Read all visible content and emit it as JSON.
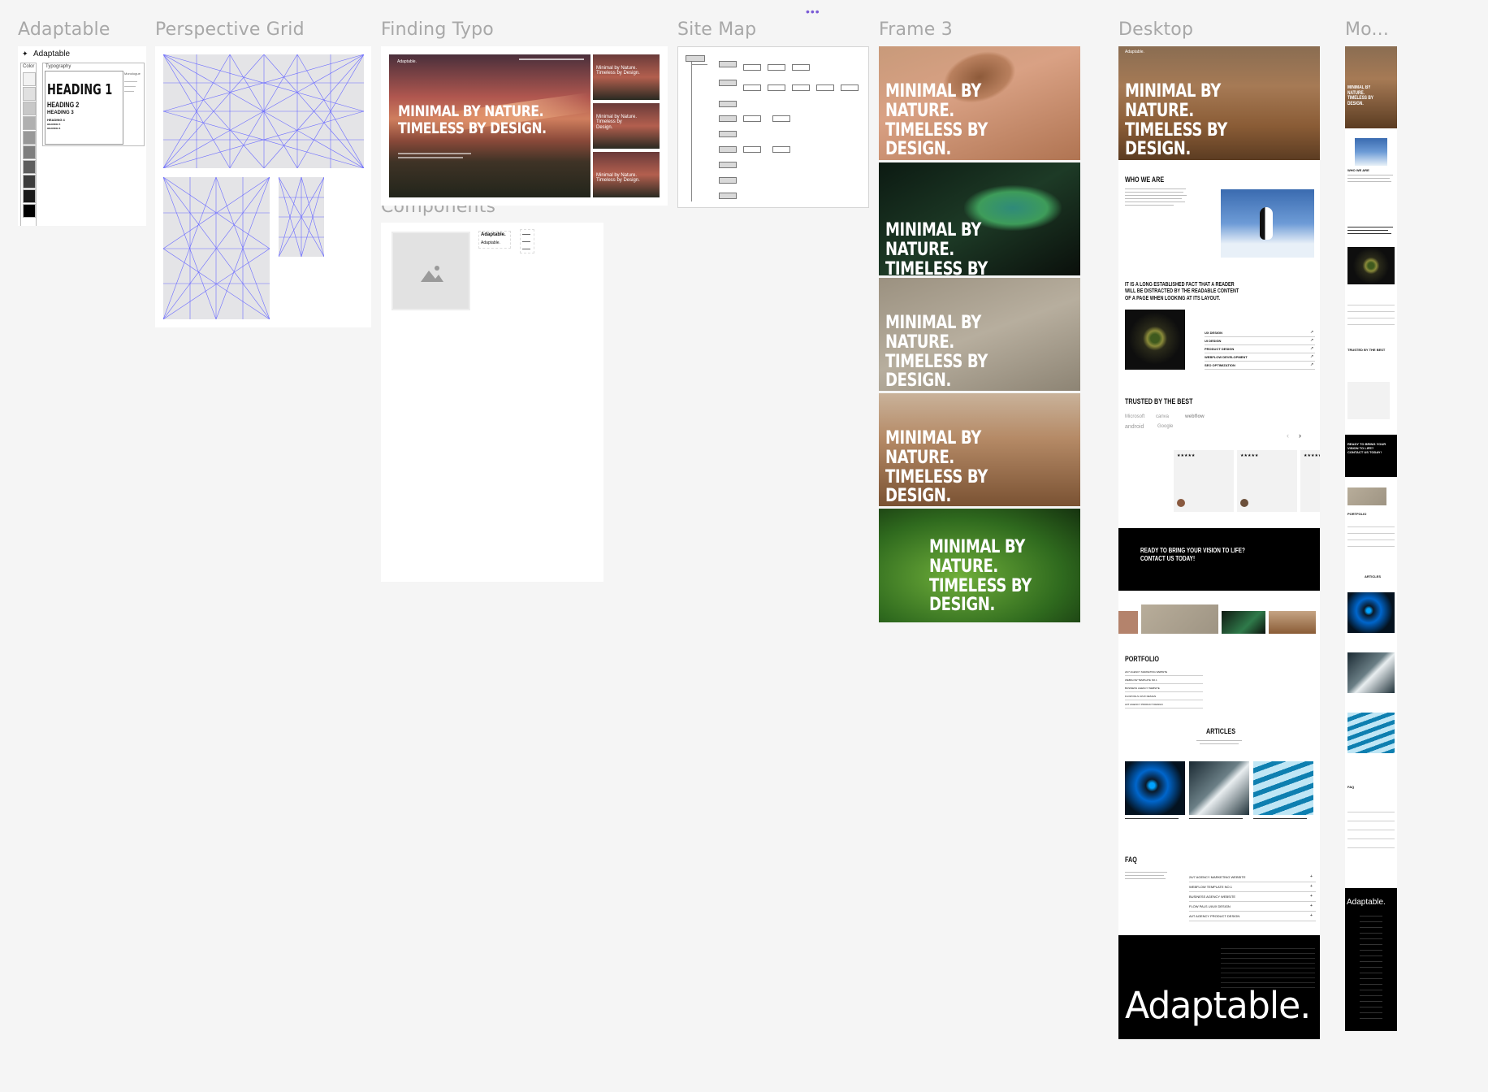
{
  "frames": {
    "adaptable": {
      "label": "Adaptable",
      "brand": "Adaptable",
      "color_label": "Color",
      "typography_label": "Typography",
      "heading1": "HEADING 1",
      "heading2": "HEADING 2",
      "heading3": "HEADING 3",
      "heading4": "HEADING 4",
      "heading5": "HEADING 5",
      "heading6": "HEADING 6",
      "side_label": "Monologue",
      "swatches": [
        "#f2f2f2",
        "#e0e0e0",
        "#c8c8c8",
        "#b0b0b0",
        "#989898",
        "#7e7e7e",
        "#5e5e5e",
        "#3c3c3c",
        "#1a1a1a",
        "#000000"
      ]
    },
    "perspective": {
      "label": "Perspective Grid"
    },
    "finding_typo": {
      "label": "Finding Typo",
      "brand": "Adaptable.",
      "hero_title_1": "MINIMAL BY NATURE.",
      "hero_title_2": "TIMELESS BY DESIGN.",
      "thumb_text": "Minimal by Nature. Timeless by Design."
    },
    "components": {
      "label": "Components",
      "logo_1": "Adaptable.",
      "logo_2": "Adaptable.",
      "image_icon": "image-placeholder-icon"
    },
    "site_map": {
      "label": "Site Map"
    },
    "frame3": {
      "label": "Frame 3",
      "hero_title_1": "MINIMAL BY NATURE.",
      "hero_title_2": "TIMELESS BY DESIGN."
    },
    "desktop": {
      "label": "Desktop",
      "brand": "Adaptable.",
      "hero_title_1": "MINIMAL BY NATURE.",
      "hero_title_2": "TIMELESS BY DESIGN.",
      "who_we_are": "WHO WE ARE",
      "long_fact": "IT IS A LONG ESTABLISHED FACT THAT A READER WILL BE DISTRACTED BY THE READABLE CONTENT OF A PAGE WHEN LOOKING AT ITS LAYOUT.",
      "services": [
        "UX DESIGN",
        "UI DESIGN",
        "PRODUCT DESIGN",
        "WEBFLOW DEVELOPMENT",
        "SEO OPTIMIZATION"
      ],
      "trusted": "TRUSTED BY THE BEST",
      "logos": [
        "Microsoft",
        "canva",
        "webflow",
        "android",
        "Google"
      ],
      "stars": "★★★★★",
      "cta": "READY TO BRING YOUR VISION TO LIFE? CONTACT US TODAY!",
      "portfolio": "PORTFOLIO",
      "articles": "ARTICLES",
      "faq": "FAQ",
      "faq_items": [
        "24/7 AGENCY MARKETING WEBSITE",
        "WEBFLOW TEMPLATE NO.1",
        "BUSINESS AGENCY WEBSITE",
        "FLOW PALS UI/UX DESIGN",
        "AI/T AGENCY PRODUCT DESIGN"
      ],
      "footer_brand": "Adaptable."
    },
    "mobile": {
      "label": "Mo...",
      "hero_title": "MINIMAL BY NATURE. TIMELESS BY DESIGN.",
      "who_we_are": "WHO WE ARE",
      "trusted": "TRUSTED BY THE BEST",
      "cta": "READY TO BRING YOUR VISION TO LIFE? CONTACT US TODAY!",
      "portfolio": "PORTFOLIO",
      "articles": "ARTICLES",
      "faq": "FAQ",
      "footer_brand": "Adaptable."
    }
  },
  "toolbar": {
    "more_icon": "more-dots-icon",
    "more_glyph": "•••"
  },
  "colors": {
    "canvas": "#f5f5f5",
    "label": "#a8a8a8",
    "grid_line": "#6b6bff",
    "accent_purple": "#7b5cd6"
  }
}
